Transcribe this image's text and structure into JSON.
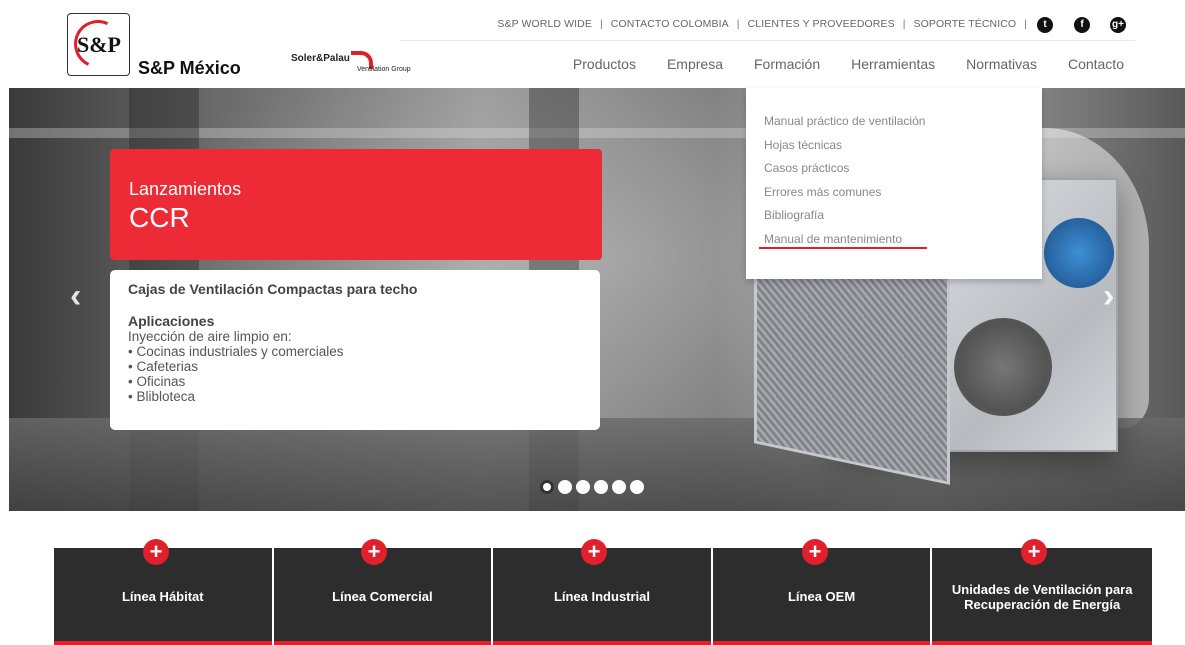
{
  "brand": {
    "logo_text": "S&P",
    "name": "S&P México",
    "partner_logo_line1": "Soler&Palau",
    "partner_logo_line2": "Ventilation Group"
  },
  "toplinks": [
    "S&P WORLD WIDE",
    "CONTACTO COLOMBIA",
    "CLIENTES Y PROVEEDORES",
    "SOPORTE TÉCNICO"
  ],
  "social": [
    {
      "icon": "twitter-icon",
      "glyph": "t"
    },
    {
      "icon": "facebook-icon",
      "glyph": "f"
    },
    {
      "icon": "google-plus-icon",
      "glyph": "g+"
    }
  ],
  "nav": [
    "Productos",
    "Empresa",
    "Formación",
    "Herramientas",
    "Normativas",
    "Contacto"
  ],
  "dropdown": [
    "Manual práctico de ventilación",
    "Hojas técnicas",
    "Casos prácticos",
    "Errores más comunes",
    "Bibliografía",
    "Manual de mantenimiento"
  ],
  "hero": {
    "kicker": "Lanzamientos",
    "title": "CCR",
    "card_heading": "Cajas de Ventilación Compactas para techo",
    "applications_title": "Aplicaciones",
    "applications_intro": "Inyección de aire limpio en:",
    "applications": [
      "• Cocinas industriales y comerciales",
      "• Cafeterias",
      "• Oficinas",
      "• Blibloteca"
    ],
    "slide_count": 6,
    "active_slide": 1
  },
  "product_lines": [
    "Línea Hábitat",
    "Línea Comercial",
    "Línea Industrial",
    "Línea OEM",
    "Unidades de Ventilación para Recuperación de Energía"
  ],
  "colors": {
    "accent": "#e1202b",
    "card_red": "#ec2b36",
    "tile": "#2d2d2d"
  }
}
